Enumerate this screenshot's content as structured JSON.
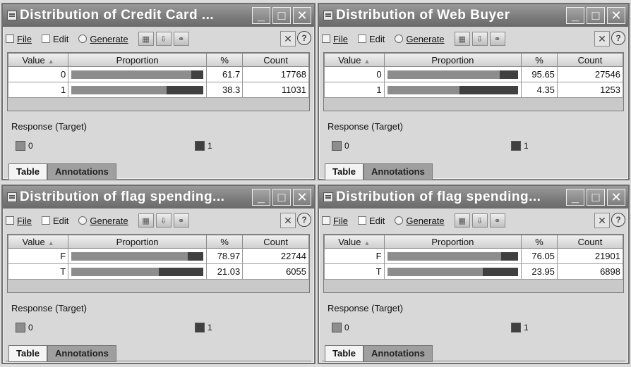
{
  "colors": {
    "bar_category_0": "#8d8d8d",
    "bar_category_1": "#404040"
  },
  "windows": [
    {
      "title": "Distribution of Credit Card ...",
      "toolbar": {
        "file": "File",
        "edit": "Edit",
        "generate": "Generate"
      },
      "columns": {
        "value": "Value",
        "proportion": "Proportion",
        "percent": "%",
        "count": "Count"
      },
      "rows": [
        {
          "value": "0",
          "percent": "61.7",
          "count": "17768",
          "proportion_of_0": 0.91
        },
        {
          "value": "1",
          "percent": "38.3",
          "count": "11031",
          "proportion_of_0": 0.72
        }
      ],
      "legend": {
        "title": "Response (Target)",
        "item0": "0",
        "item1": "1"
      },
      "tabs": {
        "table": "Table",
        "annotations": "Annotations"
      }
    },
    {
      "title": "Distribution of Web Buyer",
      "toolbar": {
        "file": "File",
        "edit": "Edit",
        "generate": "Generate"
      },
      "columns": {
        "value": "Value",
        "proportion": "Proportion",
        "percent": "%",
        "count": "Count"
      },
      "rows": [
        {
          "value": "0",
          "percent": "95.65",
          "count": "27546",
          "proportion_of_0": 0.86
        },
        {
          "value": "1",
          "percent": "4.35",
          "count": "1253",
          "proportion_of_0": 0.55
        }
      ],
      "legend": {
        "title": "Response (Target)",
        "item0": "0",
        "item1": "1"
      },
      "tabs": {
        "table": "Table",
        "annotations": "Annotations"
      }
    },
    {
      "title": "Distribution of flag spending...",
      "toolbar": {
        "file": "File",
        "edit": "Edit",
        "generate": "Generate"
      },
      "columns": {
        "value": "Value",
        "proportion": "Proportion",
        "percent": "%",
        "count": "Count"
      },
      "rows": [
        {
          "value": "F",
          "percent": "78.97",
          "count": "22744",
          "proportion_of_0": 0.88
        },
        {
          "value": "T",
          "percent": "21.03",
          "count": "6055",
          "proportion_of_0": 0.66
        }
      ],
      "legend": {
        "title": "Response (Target)",
        "item0": "0",
        "item1": "1"
      },
      "tabs": {
        "table": "Table",
        "annotations": "Annotations"
      }
    },
    {
      "title": "Distribution of flag spending...",
      "toolbar": {
        "file": "File",
        "edit": "Edit",
        "generate": "Generate"
      },
      "columns": {
        "value": "Value",
        "proportion": "Proportion",
        "percent": "%",
        "count": "Count"
      },
      "rows": [
        {
          "value": "F",
          "percent": "76.05",
          "count": "21901",
          "proportion_of_0": 0.87
        },
        {
          "value": "T",
          "percent": "23.95",
          "count": "6898",
          "proportion_of_0": 0.73
        }
      ],
      "legend": {
        "title": "Response (Target)",
        "item0": "0",
        "item1": "1"
      },
      "tabs": {
        "table": "Table",
        "annotations": "Annotations"
      }
    }
  ]
}
